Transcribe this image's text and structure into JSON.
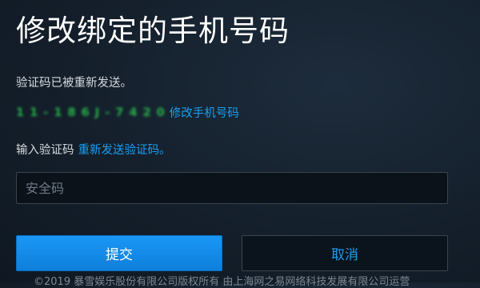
{
  "page": {
    "title": "修改绑定的手机号码",
    "resent_message": "验证码已被重新发送。",
    "phone_number": "1 1 - 1 8 6 J - 7 4 2 0",
    "change_phone_link": "修改手机号码",
    "code_label": "输入验证码",
    "resend_link": "重新发送验证码。",
    "code_input": {
      "value": "",
      "placeholder": "安全码"
    },
    "submit_label": "提交",
    "cancel_label": "取消",
    "footer": "©2019 暴雪娱乐股份有限公司版权所有 由上海网之易网络科技发展有限公司运营"
  },
  "colors": {
    "background": "#141f2b",
    "link": "#1a9ef0",
    "primary_button": "#148eff",
    "phone_masked": "#29b34a"
  }
}
